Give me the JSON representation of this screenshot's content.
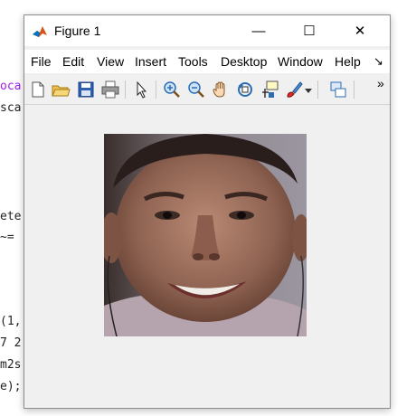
{
  "editor": {
    "lines": [
      {
        "text": "oca",
        "purple": true
      },
      {
        "text": "sca",
        "purple": false
      },
      {
        "text": "ete",
        "purple": false
      },
      {
        "text": "~=",
        "purple": false
      },
      {
        "text": "(1,",
        "purple": false
      },
      {
        "text": "7 2",
        "purple": false
      },
      {
        "text": "m2s",
        "purple": false
      },
      {
        "text": "e);",
        "purple": false
      }
    ]
  },
  "window": {
    "title": "Figure 1",
    "controls": {
      "minimize": "—",
      "maximize": "☐",
      "close": "✕"
    }
  },
  "menu": {
    "items": [
      "File",
      "Edit",
      "View",
      "Insert",
      "Tools",
      "Desktop",
      "Window",
      "Help"
    ],
    "overflow": "↘"
  },
  "toolbar": {
    "overflow": "»",
    "buttons": [
      "new-figure-icon",
      "open-file-icon",
      "save-icon",
      "print-icon",
      "pointer-icon",
      "zoom-in-icon",
      "zoom-out-icon",
      "pan-hand-icon",
      "rotate-3d-icon",
      "data-cursor-icon",
      "brush-icon",
      "brush-dropdown-icon",
      "link-plot-icon"
    ]
  },
  "figure": {
    "image_description": "photo-portrait",
    "accent": "#0072bd"
  }
}
